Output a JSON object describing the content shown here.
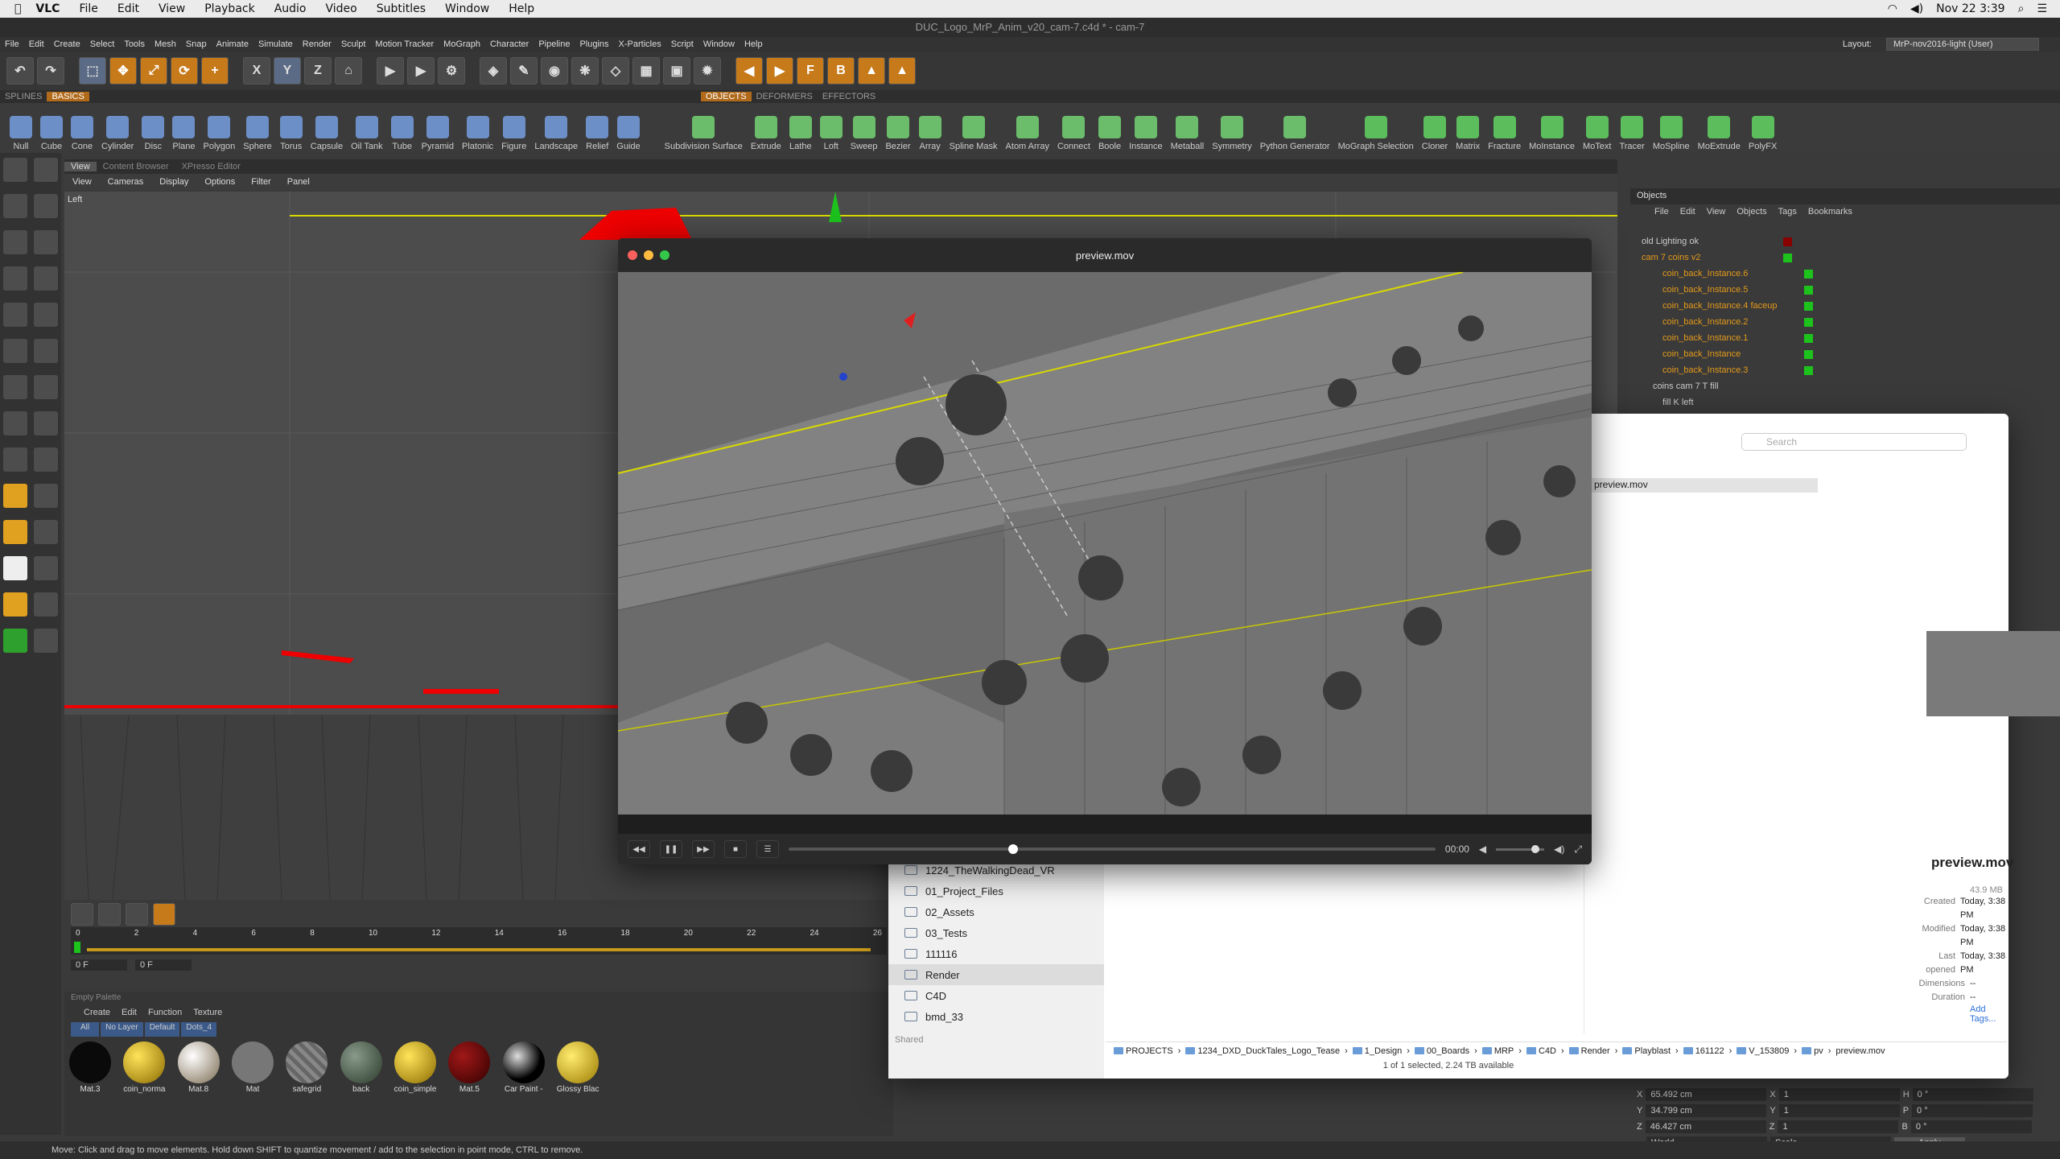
{
  "menubar": {
    "app": "VLC",
    "items": [
      "File",
      "Edit",
      "View",
      "Playback",
      "Audio",
      "Video",
      "Subtitles",
      "Window",
      "Help"
    ],
    "clock": "Nov 22  3:39"
  },
  "c4d": {
    "title": "DUC_Logo_MrP_Anim_v20_cam-7.c4d * - cam-7",
    "menu": [
      "File",
      "Edit",
      "Create",
      "Select",
      "Tools",
      "Mesh",
      "Snap",
      "Animate",
      "Simulate",
      "Render",
      "Sculpt",
      "Motion Tracker",
      "MoGraph",
      "Character",
      "Pipeline",
      "Plugins",
      "X-Particles",
      "Script",
      "Window",
      "Help"
    ],
    "layout_label": "Layout:",
    "layout_value": "MrP-nov2016-light (User)",
    "tabs_left": [
      "SPLINES",
      "BASICS"
    ],
    "tabs_right": [
      "OBJECTS",
      "DEFORMERS",
      "EFFECTORS"
    ],
    "basics": [
      "Null",
      "Cube",
      "Cone",
      "Cylinder",
      "Disc",
      "Plane",
      "Polygon",
      "Sphere",
      "Torus",
      "Capsule",
      "Oil Tank",
      "Tube",
      "Pyramid",
      "Platonic",
      "Figure",
      "Landscape",
      "Relief",
      "Guide"
    ],
    "objects": [
      "Subdivision Surface",
      "Extrude",
      "Lathe",
      "Loft",
      "Sweep",
      "Bezier",
      "Array",
      "Spline Mask",
      "Atom Array",
      "Connect",
      "Boole",
      "Instance",
      "Metaball",
      "Symmetry",
      "Python Generator",
      "MoGraph Selection",
      "Cloner",
      "Matrix",
      "Fracture",
      "MoInstance",
      "MoText",
      "Tracer",
      "MoSpline",
      "MoExtrude",
      "PolyFX"
    ],
    "viewport_tabs": [
      "View",
      "Content Browser",
      "XPresso Editor"
    ],
    "viewport_menu": [
      "View",
      "Cameras",
      "Display",
      "Options",
      "Filter",
      "Panel"
    ],
    "viewport_label": "Left",
    "timeline_ticks": [
      "0",
      "2",
      "4",
      "6",
      "8",
      "10",
      "12",
      "14",
      "16",
      "18",
      "20",
      "22",
      "24",
      "26"
    ],
    "frame_field": "0 F",
    "frame_field2": "0 F",
    "palette_label": "Empty Palette",
    "mat_menu": [
      "Create",
      "Edit",
      "Function",
      "Texture"
    ],
    "mat_filters": [
      "All",
      "No Layer",
      "Default",
      "Dots_4"
    ],
    "materials": [
      "Mat.3",
      "coin_norma",
      "Mat.8",
      "Mat",
      "safegrid",
      "back",
      "coin_simple",
      "Mat.5",
      "Car Paint -",
      "Glossy Blac"
    ],
    "status": "Move: Click and drag to move elements. Hold down SHIFT to quantize movement / add to the selection in point mode, CTRL to remove.",
    "objects_panel": {
      "title": "Objects",
      "menu": [
        "File",
        "Edit",
        "View",
        "Objects",
        "Tags",
        "Bookmarks"
      ],
      "rows": [
        {
          "name": "old Lighting ok",
          "sel": false
        },
        {
          "name": "cam 7 coins v2",
          "sel": true
        },
        {
          "name": "coin_back_Instance.6",
          "sel": true
        },
        {
          "name": "coin_back_Instance.5",
          "sel": true
        },
        {
          "name": "coin_back_Instance.4 faceup",
          "sel": true
        },
        {
          "name": "coin_back_Instance.2",
          "sel": true
        },
        {
          "name": "coin_back_Instance.1",
          "sel": true
        },
        {
          "name": "coin_back_Instance",
          "sel": true
        },
        {
          "name": "coin_back_Instance.3",
          "sel": true
        },
        {
          "name": "coins cam 7 T fill",
          "sel": false
        },
        {
          "name": "fill K left",
          "sel": false
        }
      ]
    },
    "coords": {
      "x": "65.492 cm",
      "y": "34.799 cm",
      "z": "46.427 cm",
      "sx": "1",
      "sy": "1",
      "sz": "1",
      "h": "0 °",
      "p": "0 °",
      "b": "0 °",
      "mode1": "World",
      "mode2": "Scale",
      "apply": "Apply"
    }
  },
  "vlc": {
    "title": "preview.mov",
    "time": "00:00"
  },
  "finder": {
    "search_placeholder": "Search",
    "selected_file": "preview.mov",
    "sidebar": [
      "1224_TheWalkingDead_VR",
      "01_Project_Files",
      "02_Assets",
      "03_Tests",
      "111116",
      "Render",
      "C4D",
      "bmd_33"
    ],
    "shared_label": "Shared",
    "preview_name": "preview.mov",
    "size": "43.9 MB",
    "info": [
      {
        "k": "Created",
        "v": "Today, 3:38 PM"
      },
      {
        "k": "Modified",
        "v": "Today, 3:38 PM"
      },
      {
        "k": "Last opened",
        "v": "Today, 3:38 PM"
      },
      {
        "k": "Dimensions",
        "v": "--"
      },
      {
        "k": "Duration",
        "v": "--"
      }
    ],
    "add_tags": "Add Tags...",
    "path": [
      "PROJECTS",
      "1234_DXD_DuckTales_Logo_Tease",
      "1_Design",
      "00_Boards",
      "MRP",
      "C4D",
      "Render",
      "Playblast",
      "161122",
      "V_153809",
      "pv",
      "preview.mov"
    ],
    "status": "1 of 1 selected, 2.24 TB available"
  }
}
